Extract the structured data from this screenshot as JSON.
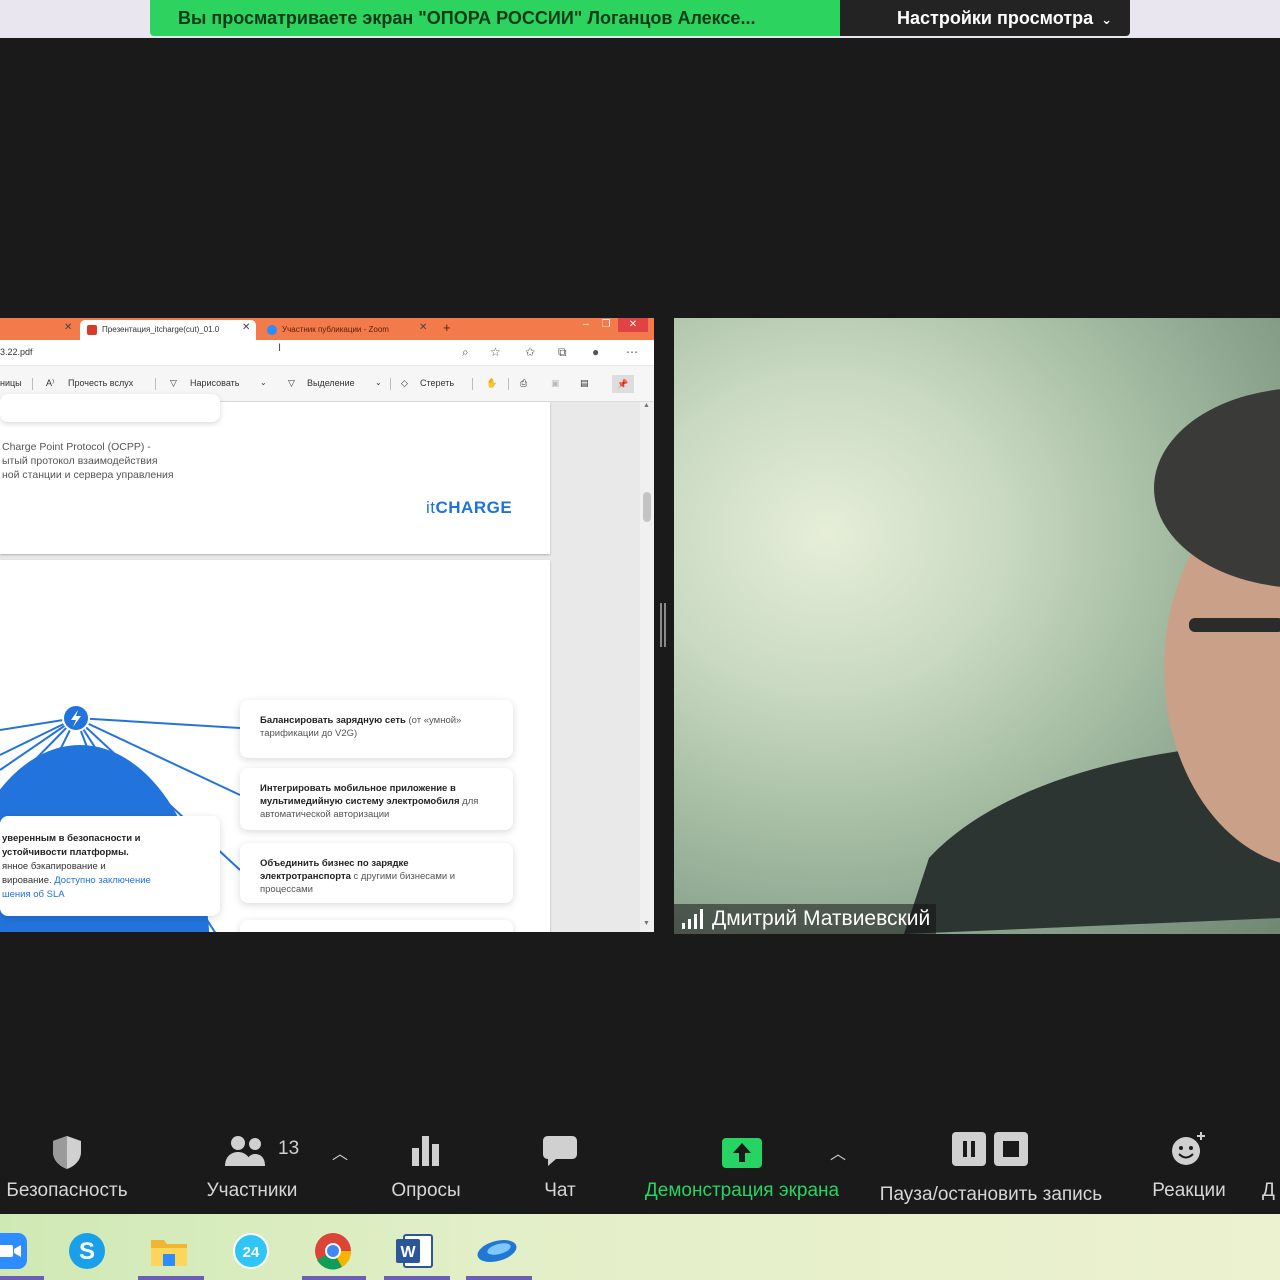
{
  "banner": {
    "message": "Вы просматриваете экран \"ОПОРА РОССИИ\" Логанцов Алексе...",
    "view_options": "Настройки просмотра"
  },
  "shared_screen": {
    "tabs": [
      {
        "label": "Презентация_itcharge(cut)_01.0"
      },
      {
        "label": "Участник публикации - Zoom"
      }
    ],
    "address": "3.22.pdf",
    "pdf_toolbar": {
      "pages": "ницы",
      "read_aloud": "Прочесть вслух",
      "draw": "Нарисовать",
      "highlight": "Выделение",
      "erase": "Стереть"
    },
    "page1": {
      "ocpp_line1": "Charge Point Protocol (OCPP) -",
      "ocpp_line2": "ытый протокол взаимодействия",
      "ocpp_line3": "ной станции и сервера управления",
      "logo_it": "it",
      "logo_charge": "CHARGE"
    },
    "page2": {
      "features": [
        {
          "bold": "Балансировать зарядную сеть",
          "normal": " (от «умной» тарификации до V2G)"
        },
        {
          "bold": "Интегрировать мобильное приложение в мультимедийную систему электромобиля",
          "normal": " для автоматической авторизации"
        },
        {
          "bold": "Объединить бизнес по зарядке электротранспорта",
          "normal": " с другими бизнесами и процессами"
        }
      ],
      "security_line1": "уверенным в безопасности и",
      "security_line2": "устойчивости платформы.",
      "security_line3": "янное бэкапирование и",
      "security_line4": "вирование.",
      "security_link1": " Доступно заключение",
      "security_link2": "шения об SLA"
    }
  },
  "video": {
    "participant_name": "Дмитрий Матвиевский"
  },
  "toolbar": {
    "security": "Безопасность",
    "participants": "Участники",
    "participants_count": "13",
    "polls": "Опросы",
    "chat": "Чат",
    "share_screen": "Демонстрация экрана",
    "record": "Пауза/остановить запись",
    "reactions": "Реакции",
    "more": "Д"
  },
  "taskbar": {
    "apps": [
      "zoom-icon",
      "skype-icon",
      "file-explorer-icon",
      "bitrix24-icon",
      "chrome-icon",
      "word-icon",
      "browser-icon"
    ]
  },
  "colors": {
    "banner_green": "#2cd35f",
    "share_green": "#27d463",
    "brand_blue": "#1e73d8",
    "tab_orange": "#f37a4a"
  }
}
